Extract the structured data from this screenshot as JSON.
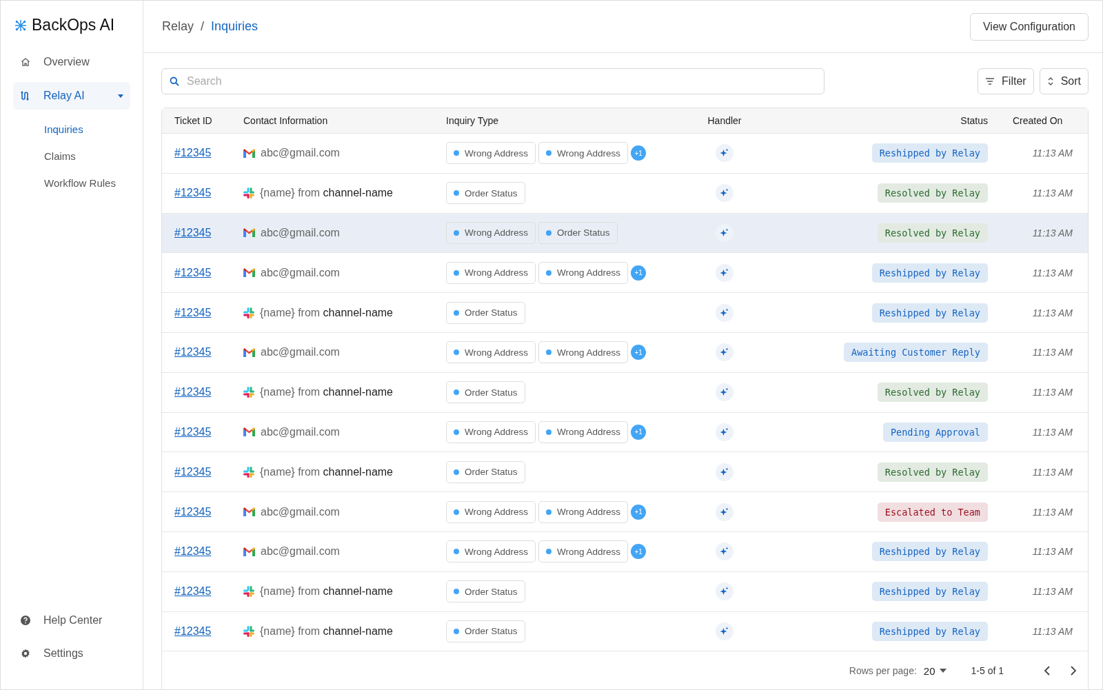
{
  "brand": "BackOps AI",
  "sidebar": {
    "items": [
      {
        "label": "Overview",
        "selected": false
      },
      {
        "label": "Relay AI",
        "selected": true,
        "expanded": true,
        "children": [
          {
            "label": "Inquiries",
            "selected": true
          },
          {
            "label": "Claims",
            "selected": false
          },
          {
            "label": "Workflow Rules",
            "selected": false
          }
        ]
      }
    ],
    "footer": [
      {
        "label": "Help Center"
      },
      {
        "label": "Settings"
      }
    ]
  },
  "breadcrumb": [
    "Relay",
    "Inquiries"
  ],
  "breadcrumb_separator": "/",
  "header_button": "View Configuration",
  "search": {
    "placeholder": "Search"
  },
  "toolbar": [
    "Filter",
    "Sort"
  ],
  "table": {
    "columns": [
      "Ticket ID",
      "Contact Information",
      "Inquiry Type",
      "Handler",
      "Status",
      "Created On"
    ],
    "rows": [
      {
        "ticket": "#12345",
        "kind": "gmail",
        "contact": "abc@gmail.com",
        "tags": [
          "Wrong Address",
          "Wrong Address"
        ],
        "more": "+1",
        "status": "Reshipped by Relay",
        "color": "#1565c0",
        "created": "11:13 AM",
        "selected": false
      },
      {
        "ticket": "#12345",
        "kind": "slack",
        "contact": "{name} from **channel-name**",
        "tags": [
          "Order Status"
        ],
        "status": "Resolved by Relay",
        "color": "#2e6b30",
        "created": "11:13 AM",
        "selected": false
      },
      {
        "ticket": "#12345",
        "kind": "gmail",
        "contact": "abc@gmail.com",
        "tags": [
          "Wrong Address",
          "Order Status"
        ],
        "status": "Resolved by Relay",
        "color": "#2e6b30",
        "created": "11:13 AM",
        "selected": true
      },
      {
        "ticket": "#12345",
        "kind": "gmail",
        "contact": "abc@gmail.com",
        "tags": [
          "Wrong Address",
          "Wrong Address"
        ],
        "more": "+1",
        "status": "Reshipped by Relay",
        "color": "#1565c0",
        "created": "11:13 AM",
        "selected": false
      },
      {
        "ticket": "#12345",
        "kind": "slack",
        "contact": "{name} from **channel-name**",
        "tags": [
          "Order Status"
        ],
        "status": "Reshipped by Relay",
        "color": "#1565c0",
        "created": "11:13 AM",
        "selected": false
      },
      {
        "ticket": "#12345",
        "kind": "gmail",
        "contact": "abc@gmail.com",
        "tags": [
          "Wrong Address",
          "Wrong Address"
        ],
        "more": "+1",
        "status": "Awaiting Customer Reply",
        "color": "#1565c0",
        "created": "11:13 AM",
        "selected": false
      },
      {
        "ticket": "#12345",
        "kind": "slack",
        "contact": "{name} from **channel-name**",
        "tags": [
          "Order Status"
        ],
        "status": "Resolved by Relay",
        "color": "#2e6b30",
        "created": "11:13 AM",
        "selected": false
      },
      {
        "ticket": "#12345",
        "kind": "gmail",
        "contact": "abc@gmail.com",
        "tags": [
          "Wrong Address",
          "Wrong Address"
        ],
        "more": "+1",
        "status": "Pending Approval",
        "color": "#1565c0",
        "created": "11:13 AM",
        "selected": false
      },
      {
        "ticket": "#12345",
        "kind": "slack",
        "contact": "{name} from **channel-name**",
        "tags": [
          "Order Status"
        ],
        "status": "Resolved by Relay",
        "color": "#2e6b30",
        "created": "11:13 AM",
        "selected": false
      },
      {
        "ticket": "#12345",
        "kind": "gmail",
        "contact": "abc@gmail.com",
        "tags": [
          "Wrong Address",
          "Wrong Address"
        ],
        "more": "+1",
        "status": "Escalated to Team",
        "color": "#9b1020",
        "created": "11:13 AM",
        "selected": false
      },
      {
        "ticket": "#12345",
        "kind": "gmail",
        "contact": "abc@gmail.com",
        "tags": [
          "Wrong Address",
          "Wrong Address"
        ],
        "more": "+1",
        "status": "Reshipped by Relay",
        "color": "#1565c0",
        "created": "11:13 AM",
        "selected": false
      },
      {
        "ticket": "#12345",
        "kind": "slack",
        "contact": "{name} from **channel-name**",
        "tags": [
          "Order Status"
        ],
        "status": "Reshipped by Relay",
        "color": "#1565c0",
        "created": "11:13 AM",
        "selected": false
      },
      {
        "ticket": "#12345",
        "kind": "slack",
        "contact": "{name} from **channel-name**",
        "tags": [
          "Order Status"
        ],
        "status": "Reshipped by Relay",
        "color": "#1565c0",
        "created": "11:13 AM",
        "selected": false
      }
    ]
  },
  "pagination": {
    "label": "Rows per page:",
    "value": "20",
    "range": "1-5 of 1"
  }
}
